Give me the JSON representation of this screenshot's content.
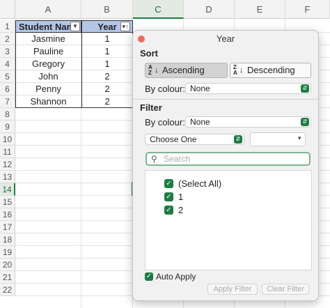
{
  "columns": [
    "A",
    "B",
    "C",
    "D",
    "E",
    "F"
  ],
  "rows": [
    "1",
    "2",
    "3",
    "4",
    "5",
    "6",
    "7",
    "8",
    "9",
    "10",
    "11",
    "12",
    "13",
    "14",
    "15",
    "16",
    "17",
    "18",
    "19",
    "20",
    "21",
    "22"
  ],
  "table": {
    "headers": [
      "Student Nam",
      "Year"
    ],
    "data": [
      [
        "Jasmine",
        "1"
      ],
      [
        "Pauline",
        "1"
      ],
      [
        "Gregory",
        "1"
      ],
      [
        "John",
        "2"
      ],
      [
        "Penny",
        "2"
      ],
      [
        "Shannon",
        "2"
      ]
    ]
  },
  "panel": {
    "title": "Year",
    "sort_section": "Sort",
    "ascending": "Ascending",
    "descending": "Descending",
    "by_colour": "By colour:",
    "sort_colour_value": "None",
    "filter_section": "Filter",
    "filter_colour_value": "None",
    "choose_one": "Choose One",
    "search_placeholder": "Search",
    "items": [
      "(Select All)",
      "1",
      "2"
    ],
    "auto_apply": "Auto Apply",
    "apply_filter": "Apply Filter",
    "clear_filter": "Clear Filter"
  },
  "colors": {
    "header_fill": "#b4c6e7",
    "accent": "#1e7b45"
  }
}
